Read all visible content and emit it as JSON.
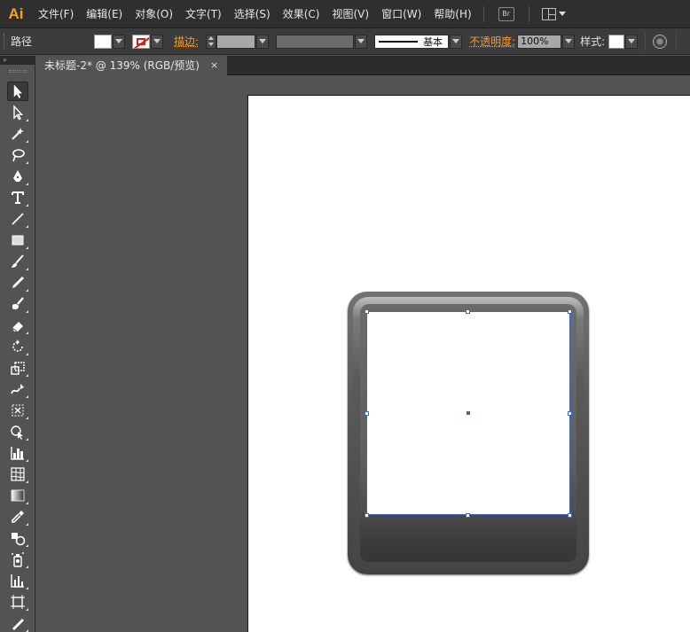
{
  "app": {
    "logo": "Ai"
  },
  "menu": [
    "文件(F)",
    "编辑(E)",
    "对象(O)",
    "文字(T)",
    "选择(S)",
    "效果(C)",
    "视图(V)",
    "窗口(W)",
    "帮助(H)"
  ],
  "menu_extras": {
    "bridge_label": "Br"
  },
  "control_bar": {
    "selection_label": "路径",
    "stroke_label": "描边:",
    "stroke_profile": "基本",
    "opacity_label": "不透明度:",
    "opacity_value": "100%",
    "style_label": "样式:"
  },
  "document_tab": {
    "title": "未标题-2* @ 139% (RGB/预览)",
    "close": "×"
  },
  "tools_header": "»",
  "tools": [
    "selection-tool",
    "direct-selection-tool",
    "magic-wand-tool",
    "lasso-tool",
    "pen-tool",
    "type-tool",
    "line-segment-tool",
    "rectangle-tool",
    "paintbrush-tool",
    "pencil-tool",
    "blob-brush-tool",
    "eraser-tool",
    "rotate-tool",
    "scale-tool",
    "warp-tool",
    "free-transform-tool",
    "shape-builder-tool",
    "column-graph-tool",
    "mesh-tool",
    "gradient-tool",
    "eyedropper-tool",
    "blend-tool",
    "symbol-sprayer-tool",
    "graph-tool",
    "artboard-tool",
    "slice-tool"
  ],
  "colors": {
    "accent_orange": "#f29a2e",
    "selection_blue": "#3a66c8",
    "fill_swatch": "#ffffff",
    "stroke_none_red": "#d02020"
  }
}
